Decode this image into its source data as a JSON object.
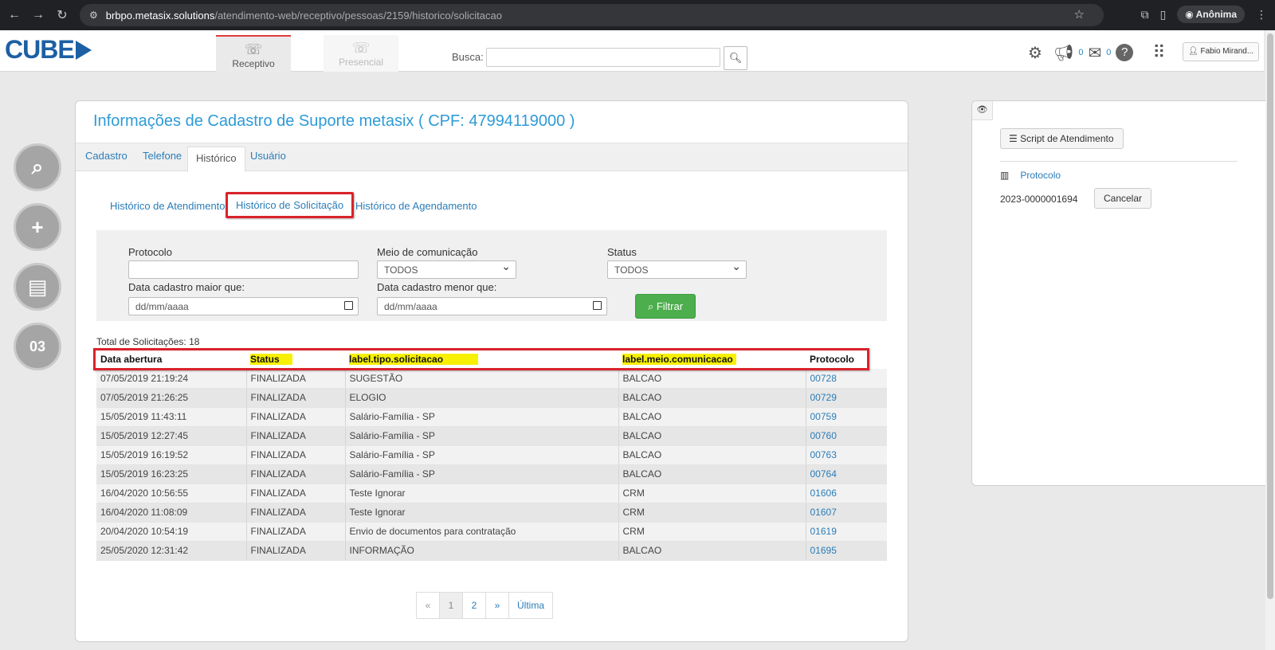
{
  "browser": {
    "url_host": "brbpo.metasix.solutions",
    "url_path": "/atendimento-web/receptivo/pessoas/2159/historico/solicitacao",
    "incognito_label": "Anônima"
  },
  "header": {
    "logo": "CUBE",
    "tabs": [
      {
        "label": "Receptivo"
      },
      {
        "label": "Presencial"
      }
    ],
    "search_label": "Busca:",
    "notif_count_1": "0",
    "notif_count_2": "0",
    "user_name": "Fabio Mirand..."
  },
  "sidebar": {
    "calendar_text": "03"
  },
  "card": {
    "title": "Informações de Cadastro de Suporte metasix ( CPF: 47994119000 )",
    "tabs": [
      {
        "label": "Cadastro"
      },
      {
        "label": "Telefone"
      },
      {
        "label": "Histórico"
      },
      {
        "label": "Usuário"
      }
    ],
    "subtabs": [
      {
        "label": "Histórico de Atendimento"
      },
      {
        "label": "Histórico de Solicitação"
      },
      {
        "label": "Histórico de Agendamento"
      }
    ]
  },
  "filters": {
    "protocolo_label": "Protocolo",
    "meio_label": "Meio de comunicação",
    "meio_value": "TODOS",
    "status_label": "Status",
    "status_value": "TODOS",
    "data_maior_label": "Data cadastro maior que:",
    "data_maior_placeholder": "dd/mm/aaaa",
    "data_menor_label": "Data cadastro menor que:",
    "data_menor_placeholder": "dd/mm/aaaa",
    "filter_button": "Filtrar"
  },
  "results": {
    "total_label": "Total de Solicitações: 18",
    "columns": [
      "Data abertura",
      "Status",
      "label.tipo.solicitacao",
      "label.meio.comunicacao",
      "Protocolo"
    ],
    "rows": [
      [
        "07/05/2019 21:19:24",
        "FINALIZADA",
        "SUGESTÃO",
        "BALCAO",
        "00728"
      ],
      [
        "07/05/2019 21:26:25",
        "FINALIZADA",
        "ELOGIO",
        "BALCAO",
        "00729"
      ],
      [
        "15/05/2019 11:43:11",
        "FINALIZADA",
        "Salário-Família - SP",
        "BALCAO",
        "00759"
      ],
      [
        "15/05/2019 12:27:45",
        "FINALIZADA",
        "Salário-Família - SP",
        "BALCAO",
        "00760"
      ],
      [
        "15/05/2019 16:19:52",
        "FINALIZADA",
        "Salário-Família - SP",
        "BALCAO",
        "00763"
      ],
      [
        "15/05/2019 16:23:25",
        "FINALIZADA",
        "Salário-Família - SP",
        "BALCAO",
        "00764"
      ],
      [
        "16/04/2020 10:56:55",
        "FINALIZADA",
        "Teste Ignorar",
        "CRM",
        "01606"
      ],
      [
        "16/04/2020 11:08:09",
        "FINALIZADA",
        "Teste Ignorar",
        "CRM",
        "01607"
      ],
      [
        "20/04/2020 10:54:19",
        "FINALIZADA",
        "Envio de documentos para contratação",
        "CRM",
        "01619"
      ],
      [
        "25/05/2020 12:31:42",
        "FINALIZADA",
        "INFORMAÇÃO",
        "BALCAO",
        "01695"
      ]
    ]
  },
  "pagination": {
    "prev": "«",
    "pages": [
      "1",
      "2"
    ],
    "next": "»",
    "last": "Última"
  },
  "right_panel": {
    "script_button": "Script de Atendimento",
    "protocolo_label": "Protocolo",
    "protocolo_value": "2023-0000001694",
    "cancel_button": "Cancelar"
  },
  "colors": {
    "accent": "#2e9bd6",
    "link": "#2b7db8",
    "highlight_box": "#d9232a",
    "highlight_text": "#f7f000",
    "filter_button": "#4cae4c"
  }
}
